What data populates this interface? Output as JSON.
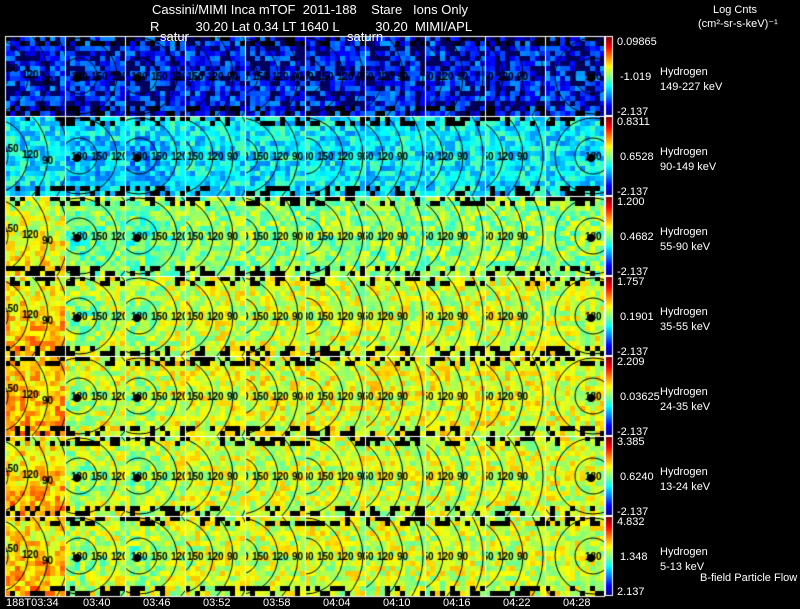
{
  "header": {
    "title_line": "Cassini/MIMI Inca mTOF  2011-188    Stare   Ions Only",
    "position_line": "R          30.20 Lat 0.34 LT 1640 L          30.20  MIMI/APL",
    "units_title": "Log Cnts",
    "units": "(cm²-sr-s-keV)⁻¹",
    "saturn_labels": [
      "satur",
      "saturn"
    ],
    "footer_note": "B-field Particle Flow"
  },
  "chart_data": {
    "type": "heatmap",
    "title": "Cassini/MIMI Inca mTOF  2011-188    Stare   Ions Only",
    "time_labels": [
      "188T03:34",
      "03:40",
      "03:46",
      "03:52",
      "03:58",
      "04:04",
      "04:10",
      "04:16",
      "04:22",
      "04:28"
    ],
    "contour_levels": [
      180,
      150,
      120,
      90
    ],
    "colormap": "jet",
    "rows": [
      {
        "species": "Hydrogen",
        "energy": "149-227 keV",
        "cbar_max": "0.09865",
        "cbar_mid": "-1.019",
        "cbar_min": "-2.137",
        "mean_level": 0.18
      },
      {
        "species": "Hydrogen",
        "energy": "90-149 keV",
        "cbar_max": "0.8311",
        "cbar_mid": "0.6528",
        "cbar_min": "-2.137",
        "mean_level": 0.36
      },
      {
        "species": "Hydrogen",
        "energy": "55-90 keV",
        "cbar_max": "1.200",
        "cbar_mid": "0.4682",
        "cbar_min": "-2.137",
        "mean_level": 0.52
      },
      {
        "species": "Hydrogen",
        "energy": "35-55 keV",
        "cbar_max": "1.757",
        "cbar_mid": "0.1901",
        "cbar_min": "-2.137",
        "mean_level": 0.58
      },
      {
        "species": "Hydrogen",
        "energy": "24-35 keV",
        "cbar_max": "2.209",
        "cbar_mid": "0.03625",
        "cbar_min": "-2.137",
        "mean_level": 0.6
      },
      {
        "species": "Hydrogen",
        "energy": "13-24 keV",
        "cbar_max": "3.385",
        "cbar_mid": "0.6240",
        "cbar_min": "-2.137",
        "mean_level": 0.58
      },
      {
        "species": "Hydrogen",
        "energy": "5-13 keV",
        "cbar_max": "4.832",
        "cbar_mid": "1.348",
        "cbar_min": "2.137",
        "mean_level": 0.58
      }
    ]
  }
}
